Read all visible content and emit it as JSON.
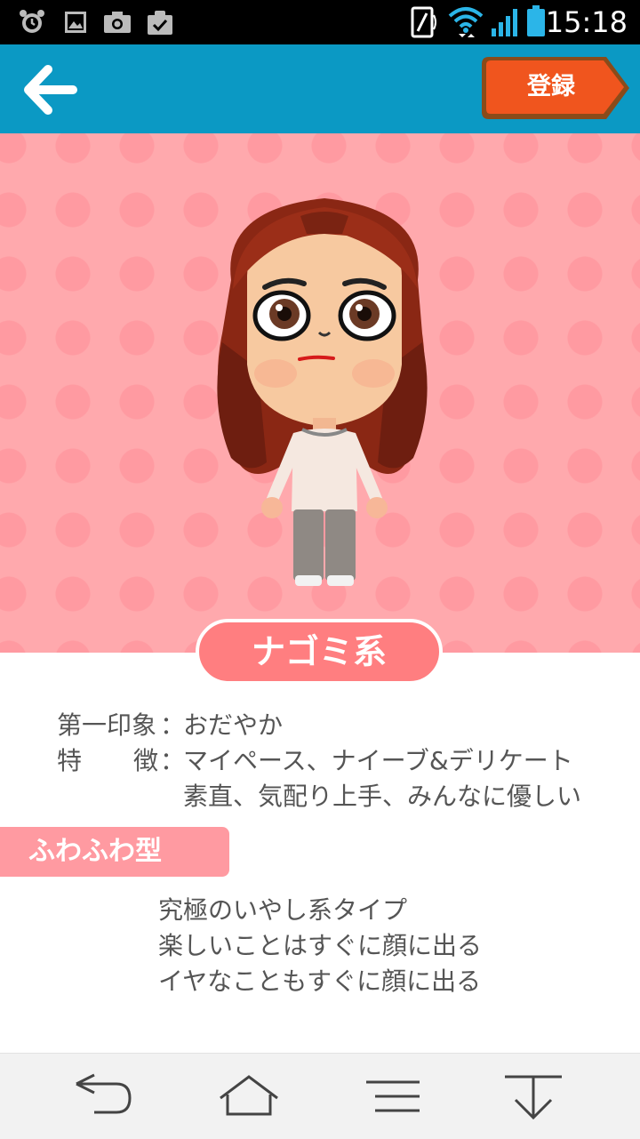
{
  "status_bar": {
    "time": "15:18",
    "icons": [
      "alarm-icon",
      "gallery-icon",
      "camera-icon",
      "task-icon",
      "nfc-icon",
      "wifi-icon",
      "signal-icon",
      "battery-icon"
    ]
  },
  "app_bar": {
    "back_icon": "arrow-left-icon",
    "register_label": "登録",
    "colors": {
      "bar": "#0b99c4",
      "register_button": "#f0551e"
    }
  },
  "type_label": "ナゴミ系",
  "details": {
    "first_impression_label": "第一印象",
    "first_impression_value": "おだやか",
    "features_label_1": "特",
    "features_label_2": "徴",
    "colon": "：",
    "features_line1": "マイペース、ナイーブ&デリケート",
    "features_line2": "素直、気配り上手、みんなに優しい"
  },
  "section": {
    "title": "ふわふわ型",
    "lines": [
      "究極のいやし系タイプ",
      "楽しいことはすぐに顔に出る",
      "イヤなこともすぐに顔に出る"
    ]
  },
  "nav_bar": {
    "icons": [
      "nav-back-icon",
      "nav-home-icon",
      "nav-menu-icon",
      "nav-hide-icon"
    ]
  },
  "colors": {
    "stage_bg": "#ffa9ad",
    "stage_dots": "#ff9aa1",
    "pill": "#ff7e80",
    "text": "#555555"
  }
}
